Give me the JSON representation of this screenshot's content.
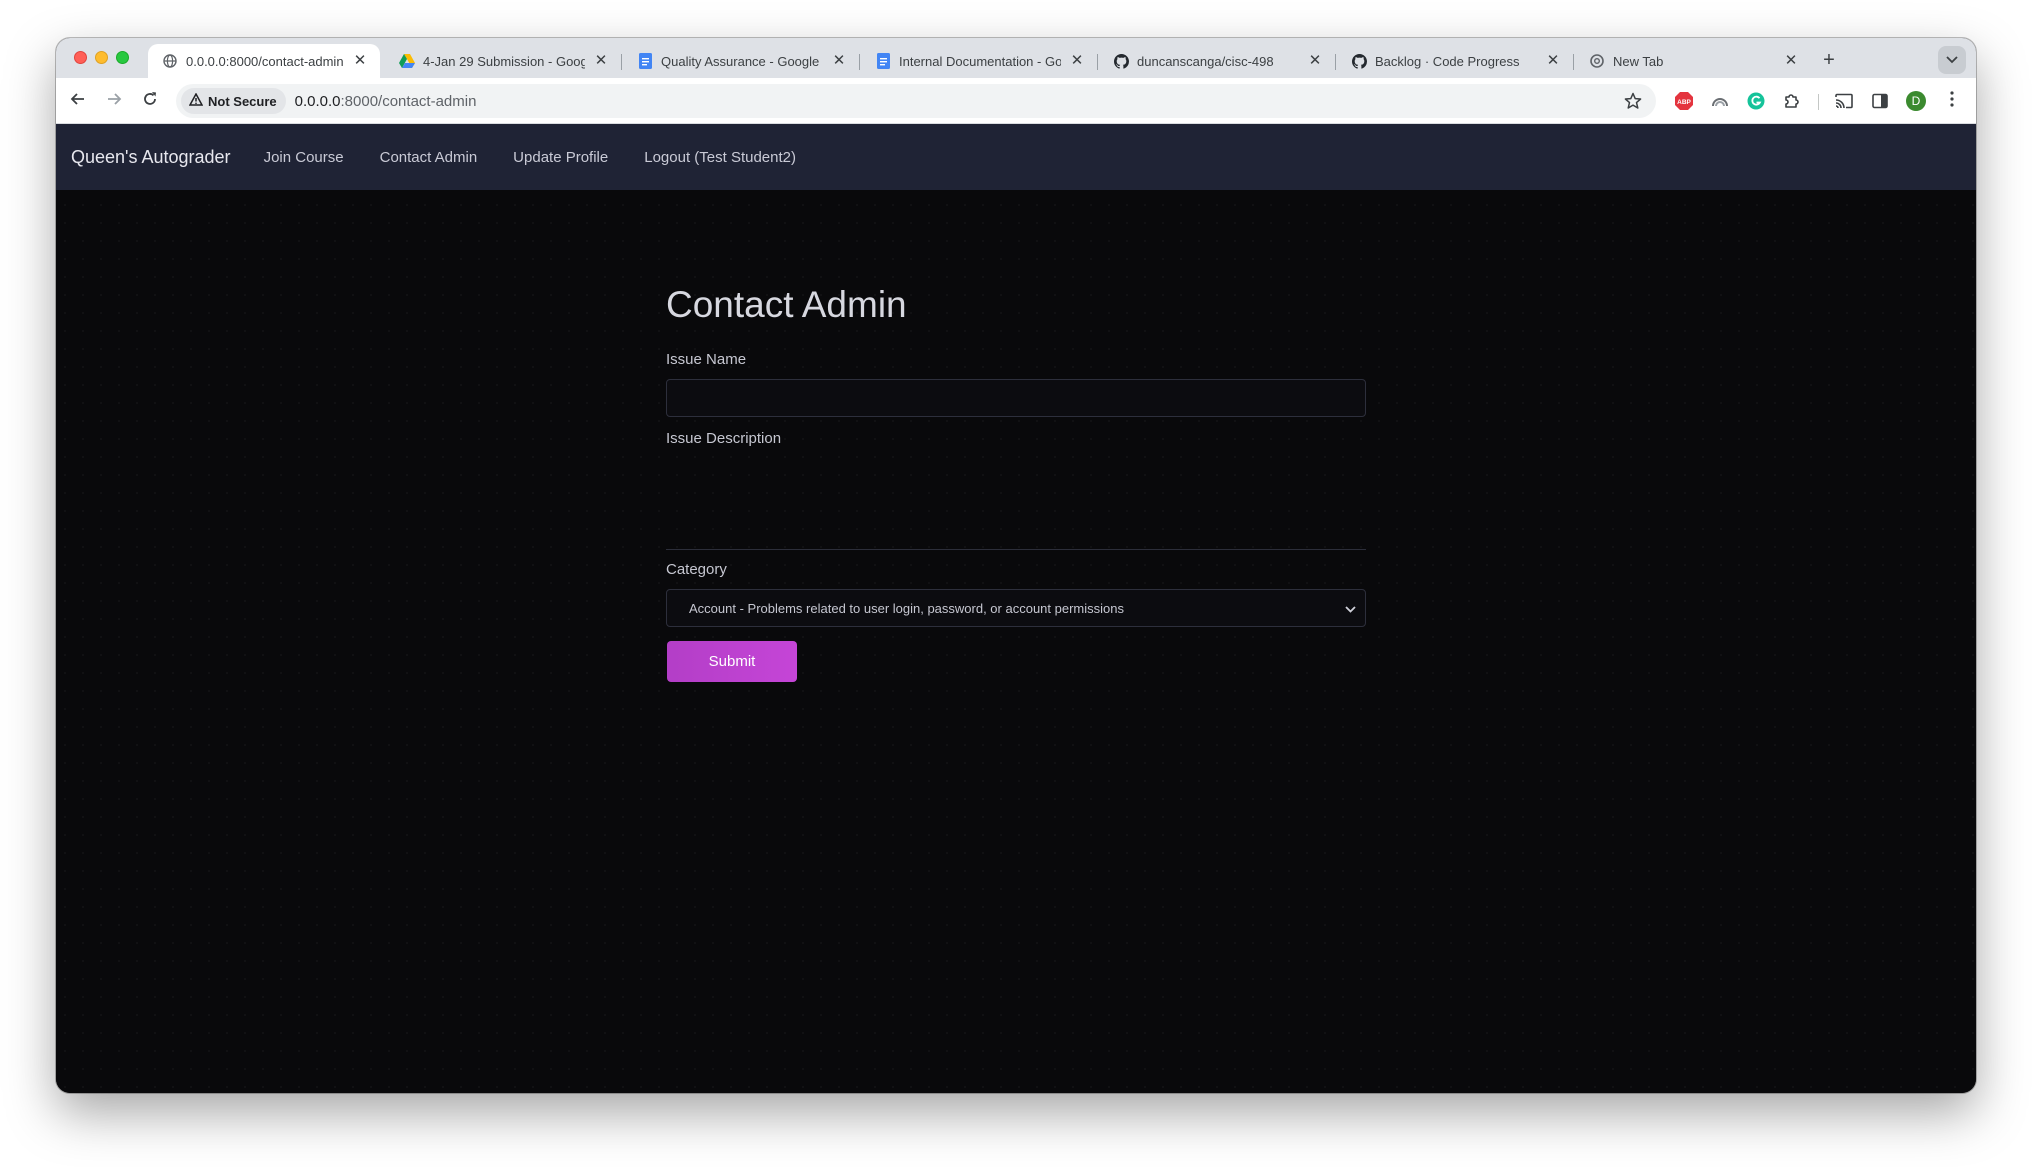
{
  "browser": {
    "tabs": [
      {
        "title": "0.0.0.0:8000/contact-admin",
        "icon": "globe-icon",
        "active": true
      },
      {
        "title": "4-Jan 29 Submission - Googl",
        "icon": "google-drive-icon",
        "active": false
      },
      {
        "title": "Quality Assurance - Google D",
        "icon": "google-docs-icon",
        "active": false
      },
      {
        "title": "Internal Documentation - Goo",
        "icon": "google-docs-icon",
        "active": false
      },
      {
        "title": "duncanscanga/cisc-498",
        "icon": "github-icon",
        "active": false
      },
      {
        "title": "Backlog · Code Progress",
        "icon": "github-icon",
        "active": false
      },
      {
        "title": "New Tab",
        "icon": "chrome-icon",
        "active": false
      }
    ],
    "security_label": "Not Secure",
    "url_host": "0.0.0.0",
    "url_rest": ":8000/contact-admin",
    "profile_initial": "D",
    "extensions": [
      "adblock-plus-icon",
      "rainbow-extension-icon",
      "grammarly-icon",
      "puzzle-extensions-icon",
      "cast-icon",
      "side-panel-icon"
    ]
  },
  "app": {
    "brand": "Queen's Autograder",
    "nav": [
      "Join Course",
      "Contact Admin",
      "Update Profile",
      "Logout (Test Student2)"
    ]
  },
  "form": {
    "title": "Contact Admin",
    "issue_name_label": "Issue Name",
    "issue_name_value": "",
    "issue_description_label": "Issue Description",
    "issue_description_value": "",
    "category_label": "Category",
    "category_selected": "Account - Problems related to user login, password, or account permissions",
    "submit_label": "Submit"
  },
  "colors": {
    "nav_bg": "#1f2335",
    "page_bg": "#09090b",
    "accent": "#c545d7"
  }
}
